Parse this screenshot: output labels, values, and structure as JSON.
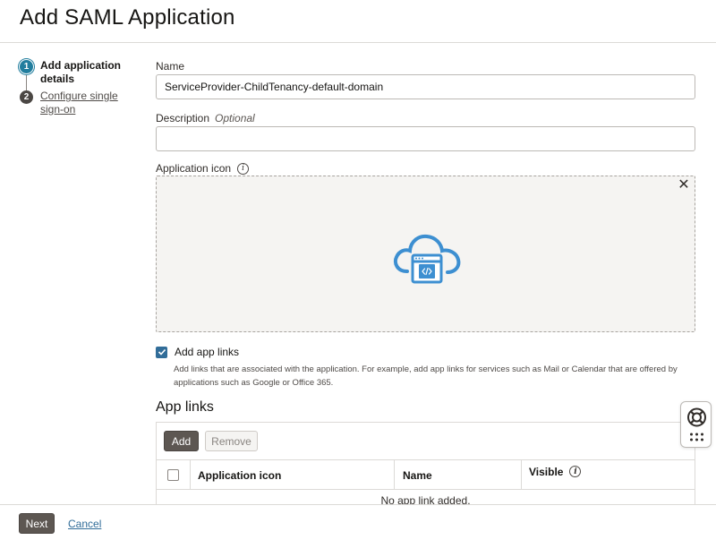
{
  "page": {
    "title": "Add SAML Application"
  },
  "steps": [
    {
      "number": "1",
      "label": "Add application details",
      "active": true
    },
    {
      "number": "2",
      "label": "Configure single sign-on",
      "active": false
    }
  ],
  "form": {
    "name_label": "Name",
    "name_value": "ServiceProvider-ChildTenancy-default-domain",
    "description_label": "Description",
    "description_optional": "Optional",
    "description_value": "",
    "icon_label": "Application icon",
    "icon_name": "cloud-application-icon",
    "add_links_label": "Add app links",
    "add_links_checked": true,
    "add_links_help": "Add links that are associated with the application. For example, add app links for services such as Mail or Calendar that are offered by applications such as Google or Office 365."
  },
  "app_links": {
    "title": "App links",
    "add_label": "Add",
    "remove_label": "Remove",
    "columns": [
      "Application icon",
      "Name",
      "Visible"
    ],
    "empty_message": "No app link added."
  },
  "footer": {
    "next_label": "Next",
    "cancel_label": "Cancel"
  },
  "colors": {
    "accent": "#227e9e",
    "link": "#316d99",
    "primary_button": "#5d5752",
    "icon_blue": "#3d8fd1"
  }
}
